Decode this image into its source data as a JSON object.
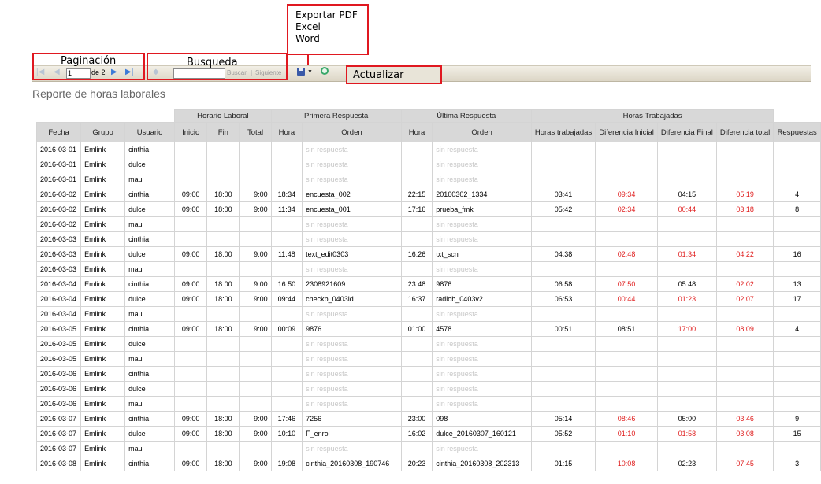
{
  "annotations": {
    "export_menu": [
      "Exportar PDF",
      "Excel",
      "Word"
    ],
    "pagination_label": "Paginación",
    "search_label": "Busqueda",
    "refresh_label": "Actualizar"
  },
  "toolbar": {
    "page_input": "1",
    "page_of": "de 2",
    "search_value": "",
    "find_label": "Buscar",
    "separator": "|",
    "next_label": "Siguiente",
    "icons": [
      "first-page-icon",
      "prev-page-icon",
      "next-page-icon",
      "last-page-icon",
      "search-back-icon",
      "save-icon",
      "refresh-icon"
    ]
  },
  "report": {
    "title": "Reporte de horas laborales",
    "group_headers": {
      "horario": "Horario Laboral",
      "primera": "Primera Respuesta",
      "ultima": "Última Respuesta",
      "horas": "Horas Trabajadas"
    },
    "columns": [
      "Fecha",
      "Grupo",
      "Usuario",
      "Inicio",
      "Fin",
      "Total",
      "Hora",
      "Orden",
      "Hora",
      "Orden",
      "Horas trabajadas",
      "Diferencia Inicial",
      "Diferencia Final",
      "Diferencia total",
      "Respuestas"
    ],
    "no_response": "sin respuesta",
    "rows": [
      {
        "fecha": "2016-03-01",
        "grupo": "Emlink",
        "usuario": "cinthia",
        "inicio": "",
        "fin": "",
        "total": "",
        "h1": "",
        "o1": "sin respuesta",
        "h2": "",
        "o2": "sin respuesta",
        "ht": "",
        "di": "",
        "df": "",
        "dt": "",
        "resp": ""
      },
      {
        "fecha": "2016-03-01",
        "grupo": "Emlink",
        "usuario": "dulce",
        "inicio": "",
        "fin": "",
        "total": "",
        "h1": "",
        "o1": "sin respuesta",
        "h2": "",
        "o2": "sin respuesta",
        "ht": "",
        "di": "",
        "df": "",
        "dt": "",
        "resp": ""
      },
      {
        "fecha": "2016-03-01",
        "grupo": "Emlink",
        "usuario": "mau",
        "inicio": "",
        "fin": "",
        "total": "",
        "h1": "",
        "o1": "sin respuesta",
        "h2": "",
        "o2": "sin respuesta",
        "ht": "",
        "di": "",
        "df": "",
        "dt": "",
        "resp": ""
      },
      {
        "fecha": "2016-03-02",
        "grupo": "Emlink",
        "usuario": "cinthia",
        "inicio": "09:00",
        "fin": "18:00",
        "total": "9:00",
        "h1": "18:34",
        "o1": "encuesta_002",
        "h2": "22:15",
        "o2": "20160302_1334",
        "ht": "03:41",
        "di": "09:34",
        "df": "04:15",
        "dt": "05:19",
        "resp": "4"
      },
      {
        "fecha": "2016-03-02",
        "grupo": "Emlink",
        "usuario": "dulce",
        "inicio": "09:00",
        "fin": "18:00",
        "total": "9:00",
        "h1": "11:34",
        "o1": "encuesta_001",
        "h2": "17:16",
        "o2": "prueba_fmk",
        "ht": "05:42",
        "di": "02:34",
        "df": "00:44",
        "dt": "03:18",
        "resp": "8"
      },
      {
        "fecha": "2016-03-02",
        "grupo": "Emlink",
        "usuario": "mau",
        "inicio": "",
        "fin": "",
        "total": "",
        "h1": "",
        "o1": "sin respuesta",
        "h2": "",
        "o2": "sin respuesta",
        "ht": "",
        "di": "",
        "df": "",
        "dt": "",
        "resp": ""
      },
      {
        "fecha": "2016-03-03",
        "grupo": "Emlink",
        "usuario": "cinthia",
        "inicio": "",
        "fin": "",
        "total": "",
        "h1": "",
        "o1": "sin respuesta",
        "h2": "",
        "o2": "sin respuesta",
        "ht": "",
        "di": "",
        "df": "",
        "dt": "",
        "resp": ""
      },
      {
        "fecha": "2016-03-03",
        "grupo": "Emlink",
        "usuario": "dulce",
        "inicio": "09:00",
        "fin": "18:00",
        "total": "9:00",
        "h1": "11:48",
        "o1": "text_edit0303",
        "h2": "16:26",
        "o2": "txt_scn",
        "ht": "04:38",
        "di": "02:48",
        "df": "01:34",
        "dt": "04:22",
        "resp": "16"
      },
      {
        "fecha": "2016-03-03",
        "grupo": "Emlink",
        "usuario": "mau",
        "inicio": "",
        "fin": "",
        "total": "",
        "h1": "",
        "o1": "sin respuesta",
        "h2": "",
        "o2": "sin respuesta",
        "ht": "",
        "di": "",
        "df": "",
        "dt": "",
        "resp": ""
      },
      {
        "fecha": "2016-03-04",
        "grupo": "Emlink",
        "usuario": "cinthia",
        "inicio": "09:00",
        "fin": "18:00",
        "total": "9:00",
        "h1": "16:50",
        "o1": "2308921609",
        "h2": "23:48",
        "o2": "9876",
        "ht": "06:58",
        "di": "07:50",
        "df": "05:48",
        "dt": "02:02",
        "resp": "13"
      },
      {
        "fecha": "2016-03-04",
        "grupo": "Emlink",
        "usuario": "dulce",
        "inicio": "09:00",
        "fin": "18:00",
        "total": "9:00",
        "h1": "09:44",
        "o1": "checkb_0403id",
        "h2": "16:37",
        "o2": "radiob_0403v2",
        "ht": "06:53",
        "di": "00:44",
        "df": "01:23",
        "dt": "02:07",
        "resp": "17"
      },
      {
        "fecha": "2016-03-04",
        "grupo": "Emlink",
        "usuario": "mau",
        "inicio": "",
        "fin": "",
        "total": "",
        "h1": "",
        "o1": "sin respuesta",
        "h2": "",
        "o2": "sin respuesta",
        "ht": "",
        "di": "",
        "df": "",
        "dt": "",
        "resp": ""
      },
      {
        "fecha": "2016-03-05",
        "grupo": "Emlink",
        "usuario": "cinthia",
        "inicio": "09:00",
        "fin": "18:00",
        "total": "9:00",
        "h1": "00:09",
        "o1": "9876",
        "h2": "01:00",
        "o2": "4578",
        "ht": "00:51",
        "di": "08:51",
        "df": "17:00",
        "dt": "08:09",
        "resp": "4"
      },
      {
        "fecha": "2016-03-05",
        "grupo": "Emlink",
        "usuario": "dulce",
        "inicio": "",
        "fin": "",
        "total": "",
        "h1": "",
        "o1": "sin respuesta",
        "h2": "",
        "o2": "sin respuesta",
        "ht": "",
        "di": "",
        "df": "",
        "dt": "",
        "resp": ""
      },
      {
        "fecha": "2016-03-05",
        "grupo": "Emlink",
        "usuario": "mau",
        "inicio": "",
        "fin": "",
        "total": "",
        "h1": "",
        "o1": "sin respuesta",
        "h2": "",
        "o2": "sin respuesta",
        "ht": "",
        "di": "",
        "df": "",
        "dt": "",
        "resp": ""
      },
      {
        "fecha": "2016-03-06",
        "grupo": "Emlink",
        "usuario": "cinthia",
        "inicio": "",
        "fin": "",
        "total": "",
        "h1": "",
        "o1": "sin respuesta",
        "h2": "",
        "o2": "sin respuesta",
        "ht": "",
        "di": "",
        "df": "",
        "dt": "",
        "resp": ""
      },
      {
        "fecha": "2016-03-06",
        "grupo": "Emlink",
        "usuario": "dulce",
        "inicio": "",
        "fin": "",
        "total": "",
        "h1": "",
        "o1": "sin respuesta",
        "h2": "",
        "o2": "sin respuesta",
        "ht": "",
        "di": "",
        "df": "",
        "dt": "",
        "resp": ""
      },
      {
        "fecha": "2016-03-06",
        "grupo": "Emlink",
        "usuario": "mau",
        "inicio": "",
        "fin": "",
        "total": "",
        "h1": "",
        "o1": "sin respuesta",
        "h2": "",
        "o2": "sin respuesta",
        "ht": "",
        "di": "",
        "df": "",
        "dt": "",
        "resp": ""
      },
      {
        "fecha": "2016-03-07",
        "grupo": "Emlink",
        "usuario": "cinthia",
        "inicio": "09:00",
        "fin": "18:00",
        "total": "9:00",
        "h1": "17:46",
        "o1": "7256",
        "h2": "23:00",
        "o2": "098",
        "ht": "05:14",
        "di": "08:46",
        "df": "05:00",
        "dt": "03:46",
        "resp": "9"
      },
      {
        "fecha": "2016-03-07",
        "grupo": "Emlink",
        "usuario": "dulce",
        "inicio": "09:00",
        "fin": "18:00",
        "total": "9:00",
        "h1": "10:10",
        "o1": "F_enrol",
        "h2": "16:02",
        "o2": "dulce_20160307_160121",
        "ht": "05:52",
        "di": "01:10",
        "df": "01:58",
        "dt": "03:08",
        "resp": "15"
      },
      {
        "fecha": "2016-03-07",
        "grupo": "Emlink",
        "usuario": "mau",
        "inicio": "",
        "fin": "",
        "total": "",
        "h1": "",
        "o1": "sin respuesta",
        "h2": "",
        "o2": "sin respuesta",
        "ht": "",
        "di": "",
        "df": "",
        "dt": "",
        "resp": ""
      },
      {
        "fecha": "2016-03-08",
        "grupo": "Emlink",
        "usuario": "cinthia",
        "inicio": "09:00",
        "fin": "18:00",
        "total": "9:00",
        "h1": "19:08",
        "o1": "cinthia_20160308_190746",
        "h2": "20:23",
        "o2": "cinthia_20160308_202313",
        "ht": "01:15",
        "di": "10:08",
        "df": "02:23",
        "dt": "07:45",
        "resp": "3"
      }
    ],
    "red_cells": {
      "3": [
        "di",
        "dt"
      ],
      "4": [
        "di",
        "df",
        "dt"
      ],
      "7": [
        "di",
        "df",
        "dt"
      ],
      "9": [
        "di",
        "dt"
      ],
      "10": [
        "di",
        "df",
        "dt"
      ],
      "12": [
        "df",
        "dt"
      ],
      "18": [
        "di",
        "dt"
      ],
      "19": [
        "di",
        "df",
        "dt"
      ],
      "21": [
        "di",
        "dt"
      ]
    }
  },
  "colors": {
    "annotation_red": "#e01820",
    "header_gray": "#d8d8d8",
    "negative_red": "#e02020"
  }
}
